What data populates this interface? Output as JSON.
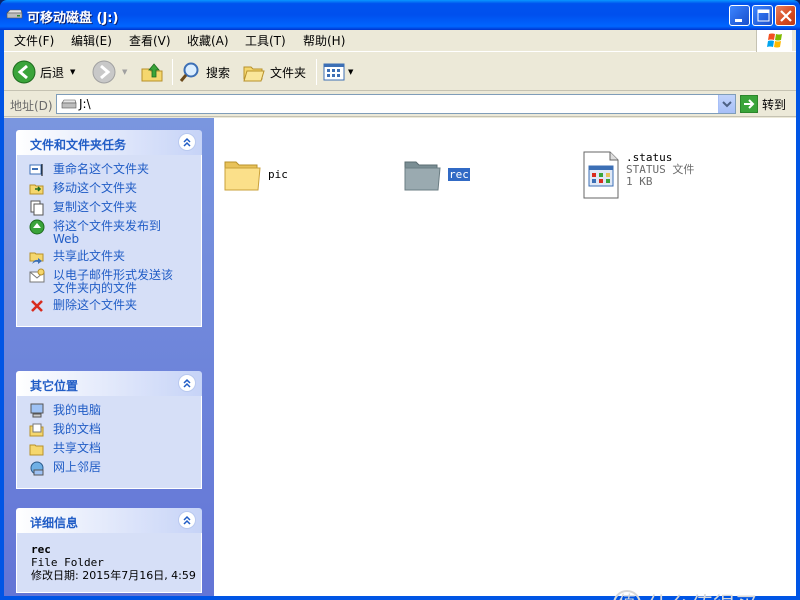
{
  "window": {
    "title": "可移动磁盘 (J:)"
  },
  "menu": {
    "items": [
      "文件(F)",
      "编辑(E)",
      "查看(V)",
      "收藏(A)",
      "工具(T)",
      "帮助(H)"
    ]
  },
  "toolbar": {
    "back_label": "后退",
    "search_label": "搜索",
    "folders_label": "文件夹"
  },
  "address": {
    "label": "地址(D)",
    "value": "J:\\",
    "go_label": "转到"
  },
  "tasks_panel": {
    "title": "文件和文件夹任务",
    "items": [
      "重命名这个文件夹",
      "移动这个文件夹",
      "复制这个文件夹",
      "将这个文件夹发布到 Web",
      "共享此文件夹",
      "以电子邮件形式发送该文件夹内的文件",
      "删除这个文件夹"
    ]
  },
  "places_panel": {
    "title": "其它位置",
    "items": [
      "我的电脑",
      "我的文档",
      "共享文档",
      "网上邻居"
    ]
  },
  "details_panel": {
    "title": "详细信息",
    "name": "rec",
    "type": "File Folder",
    "modified": "修改日期: 2015年7月16日, 4:59"
  },
  "files": [
    {
      "name": "pic",
      "kind": "folder",
      "selected": false
    },
    {
      "name": "rec",
      "kind": "folder",
      "selected": true
    },
    {
      "name": ".status",
      "kind": "file",
      "type": "STATUS 文件",
      "size": "1 KB"
    }
  ],
  "watermark": "什么值得买"
}
